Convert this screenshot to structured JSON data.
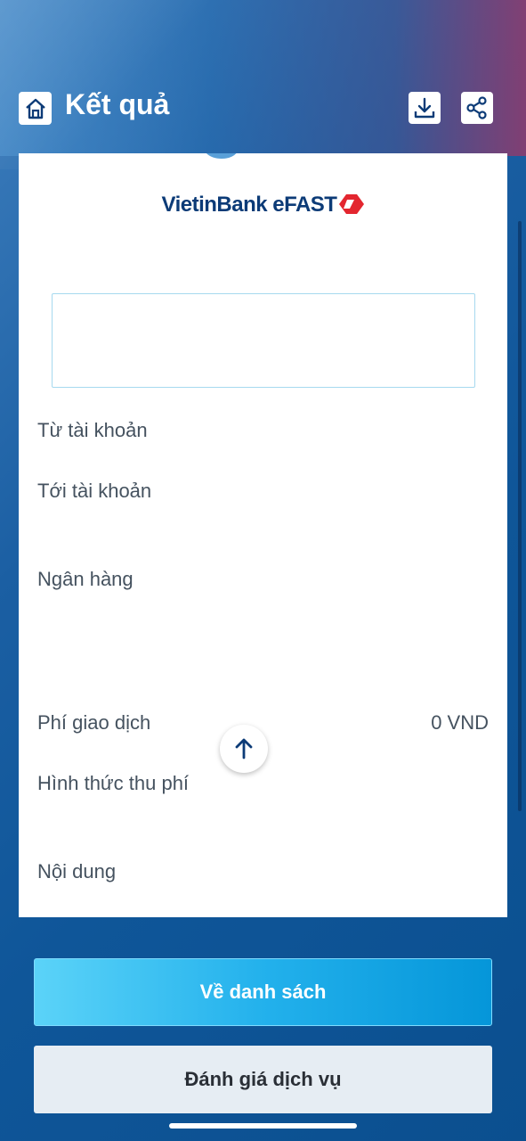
{
  "header": {
    "title": "Kết quả",
    "icons": [
      "home-icon",
      "download-icon",
      "share-icon"
    ]
  },
  "receipt": {
    "logo_text": "VietinBank eFAST",
    "amount_box": "",
    "rows": [
      {
        "label": "Từ tài khoản",
        "value": ""
      },
      {
        "label": "Tới tài khoản",
        "value": ""
      },
      {
        "label": "Ngân hàng",
        "value": ""
      },
      {
        "label": "Phí giao dịch",
        "value": "0 VND"
      },
      {
        "label": "Hình thức thu phí",
        "value": ""
      },
      {
        "label": "Nội dung",
        "value": ""
      }
    ]
  },
  "buttons": {
    "back_to_list": "Về danh sách",
    "rate_service": "Đánh giá dịch vụ"
  },
  "colors": {
    "primary_button": "#23b1ec",
    "logo_text": "#0c3b77",
    "logo_mark": "#e3262f",
    "background": "#0f5699"
  }
}
